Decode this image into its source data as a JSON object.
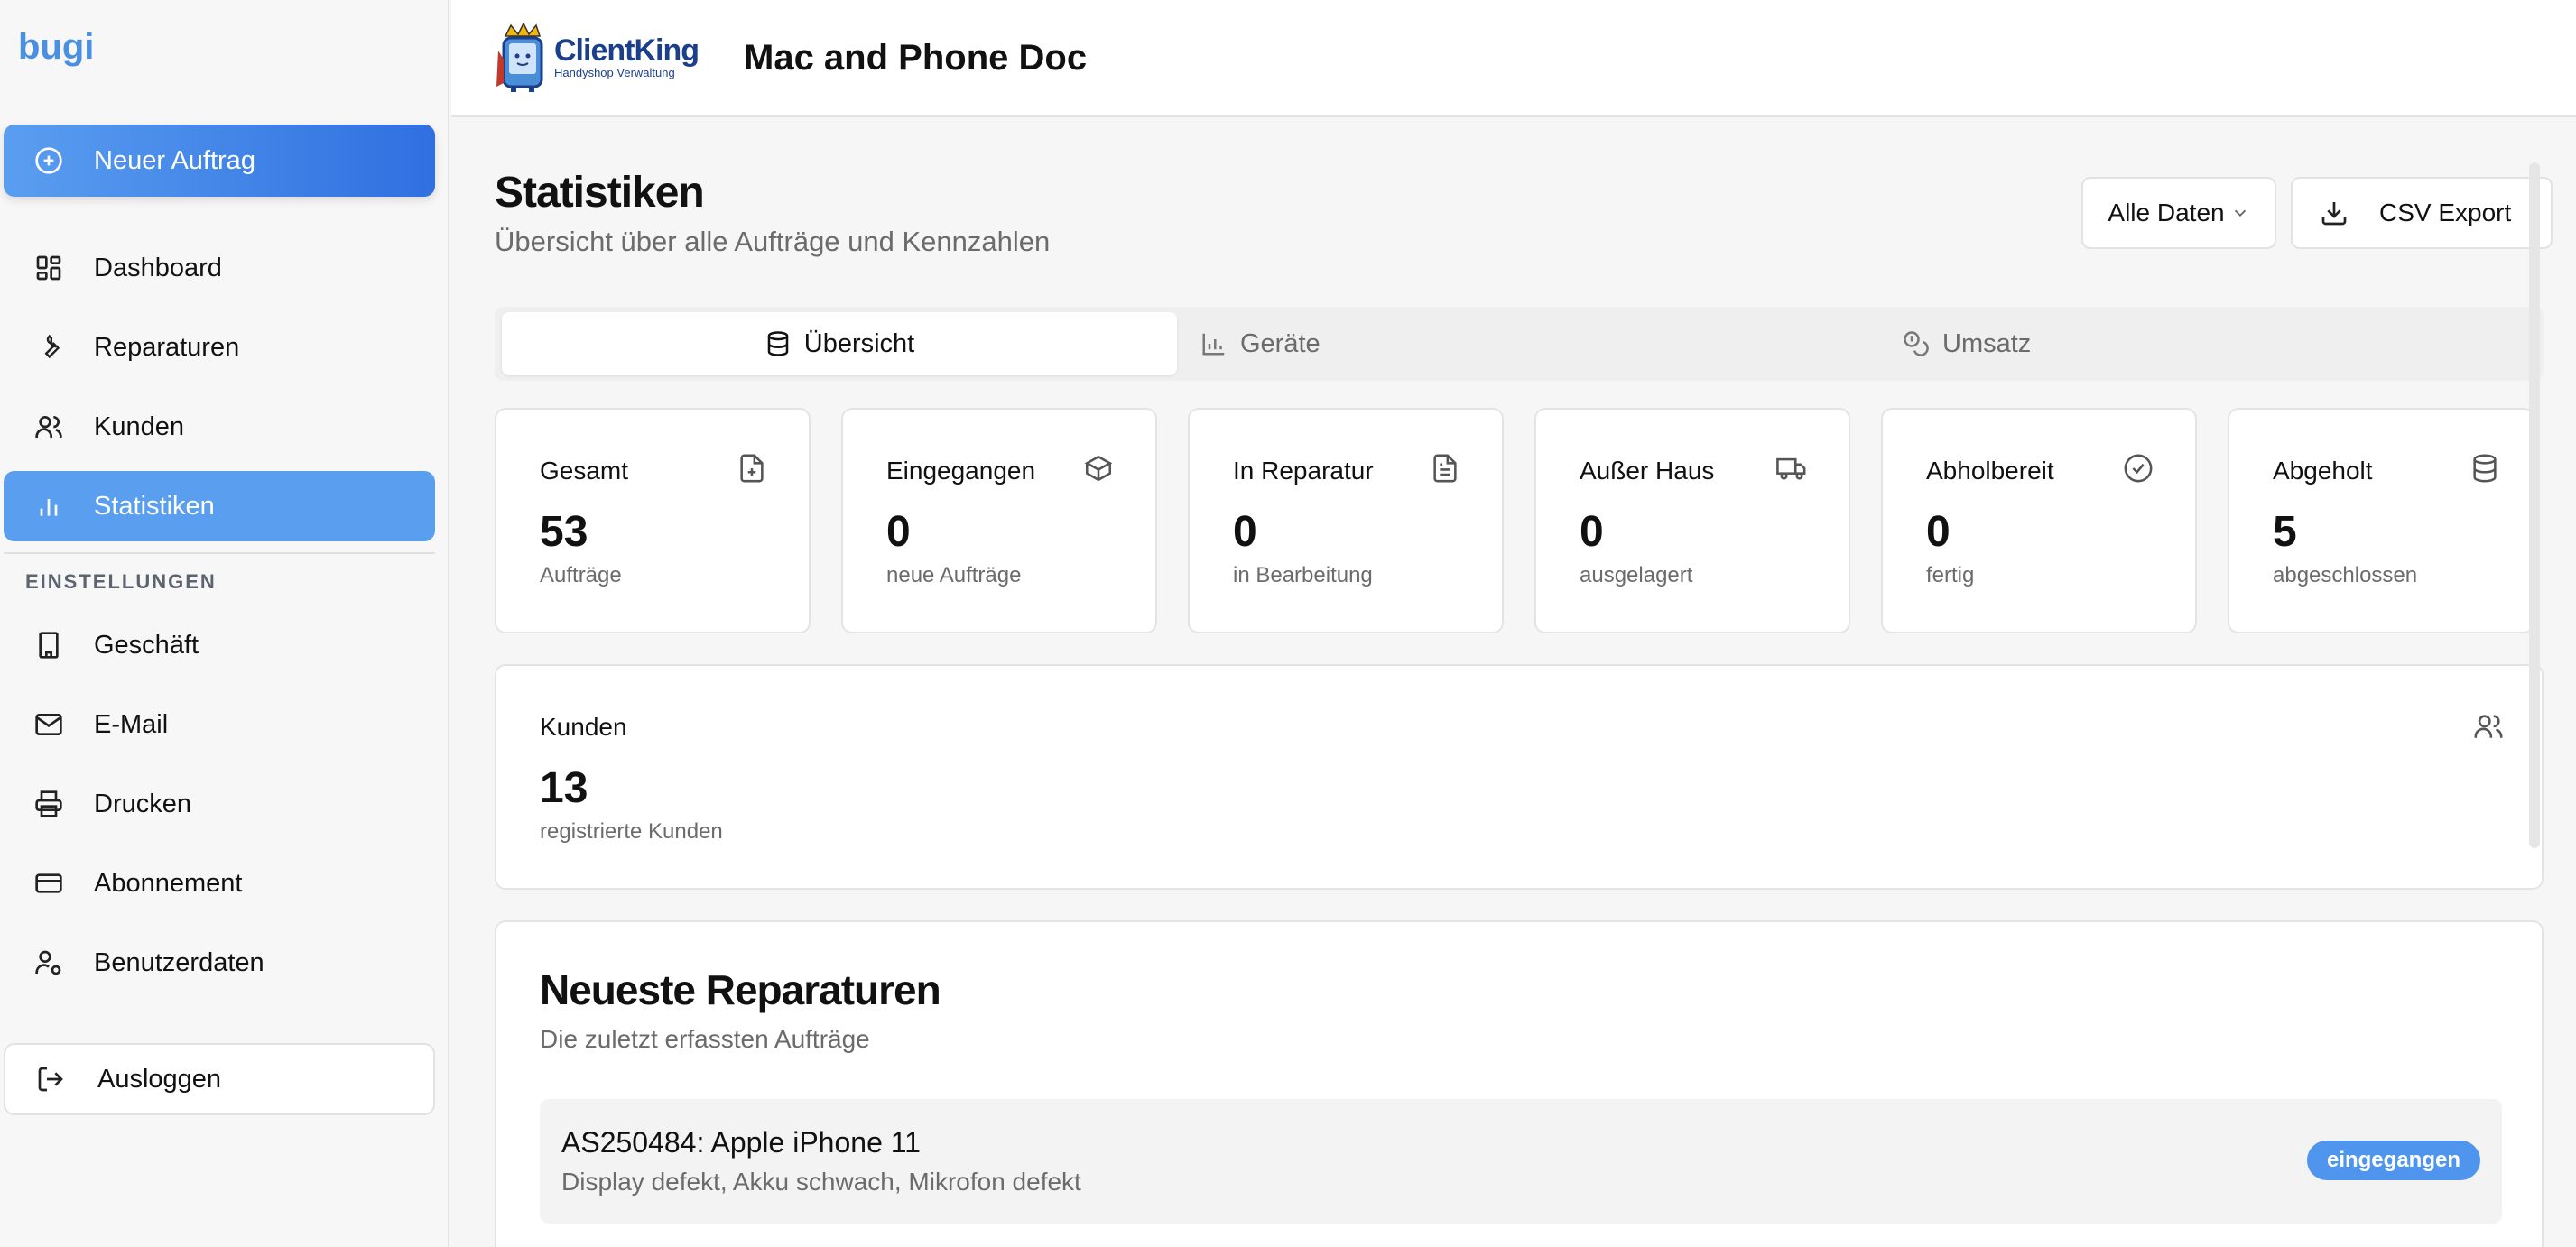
{
  "sidebar": {
    "brand": "bugi",
    "new_order": "Neuer Auftrag",
    "items": [
      {
        "label": "Dashboard",
        "icon": "dashboard-icon"
      },
      {
        "label": "Reparaturen",
        "icon": "wrench-icon"
      },
      {
        "label": "Kunden",
        "icon": "users-icon"
      },
      {
        "label": "Statistiken",
        "icon": "bar-chart-icon",
        "active": true
      }
    ],
    "settings_label": "EINSTELLUNGEN",
    "settings_items": [
      {
        "label": "Geschäft",
        "icon": "building-icon"
      },
      {
        "label": "E-Mail",
        "icon": "mail-icon"
      },
      {
        "label": "Drucken",
        "icon": "printer-icon"
      },
      {
        "label": "Abonnement",
        "icon": "credit-card-icon"
      },
      {
        "label": "Benutzerdaten",
        "icon": "user-cog-icon"
      }
    ],
    "logout": "Ausloggen"
  },
  "header": {
    "logo_title": "ClientKing",
    "logo_subtitle": "Handyshop Verwaltung",
    "shop_name": "Mac and Phone Doc"
  },
  "main": {
    "title": "Statistiken",
    "subtitle": "Übersicht über alle Aufträge und Kennzahlen",
    "filter_label": "Alle Daten",
    "csv_label": "CSV Export",
    "tabs": [
      {
        "label": "Übersicht",
        "icon": "database-icon",
        "active": true
      },
      {
        "label": "Geräte",
        "icon": "chart-icon"
      },
      {
        "label": "Umsatz",
        "icon": "coins-icon"
      }
    ],
    "stats": [
      {
        "title": "Gesamt",
        "value": "53",
        "sub": "Aufträge",
        "icon": "file-plus-icon"
      },
      {
        "title": "Eingegangen",
        "value": "0",
        "sub": "neue Aufträge",
        "icon": "package-icon"
      },
      {
        "title": "In Reparatur",
        "value": "0",
        "sub": "in Bearbeitung",
        "icon": "file-text-icon"
      },
      {
        "title": "Außer Haus",
        "value": "0",
        "sub": "ausgelagert",
        "icon": "truck-icon"
      },
      {
        "title": "Abholbereit",
        "value": "0",
        "sub": "fertig",
        "icon": "check-circle-icon"
      },
      {
        "title": "Abgeholt",
        "value": "5",
        "sub": "abgeschlossen",
        "icon": "database-icon"
      }
    ],
    "customers": {
      "title": "Kunden",
      "value": "13",
      "sub": "registrierte Kunden",
      "icon": "users-icon"
    },
    "recent": {
      "title": "Neueste Reparaturen",
      "subtitle": "Die zuletzt erfassten Aufträge",
      "items": [
        {
          "title": "AS250484: Apple iPhone 11",
          "desc": "Display defekt, Akku schwach, Mikrofon defekt",
          "status": "eingegangen"
        }
      ]
    }
  }
}
